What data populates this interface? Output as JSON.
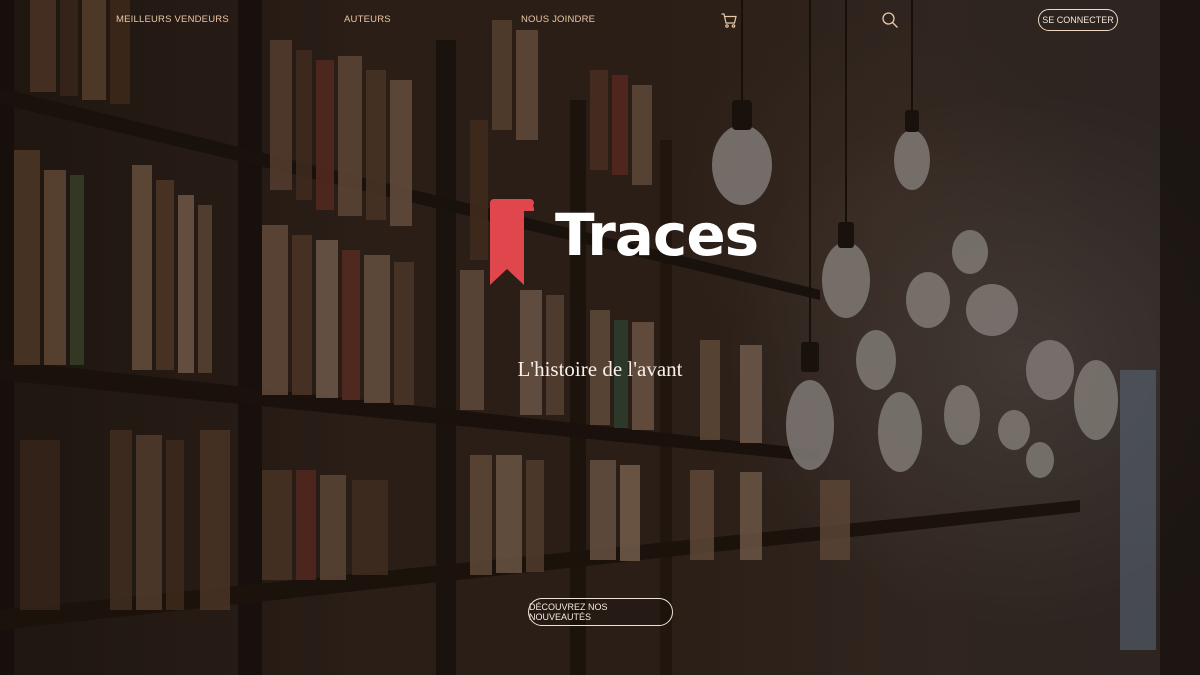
{
  "nav": {
    "items": [
      {
        "label": "Meilleurs vendeurs"
      },
      {
        "label": "Auteurs"
      },
      {
        "label": "Nous joindre"
      }
    ],
    "cart_icon": "cart-icon",
    "search_icon": "search-icon",
    "login_label": "Se connecter"
  },
  "hero": {
    "brand": "Traces",
    "tagline": "L'histoire de l'avant",
    "cta_label": "Découvrez nos nouveautés"
  },
  "colors": {
    "accent": "#e0474c",
    "nav_text": "#e9c8a6",
    "heading": "#ffffff"
  }
}
